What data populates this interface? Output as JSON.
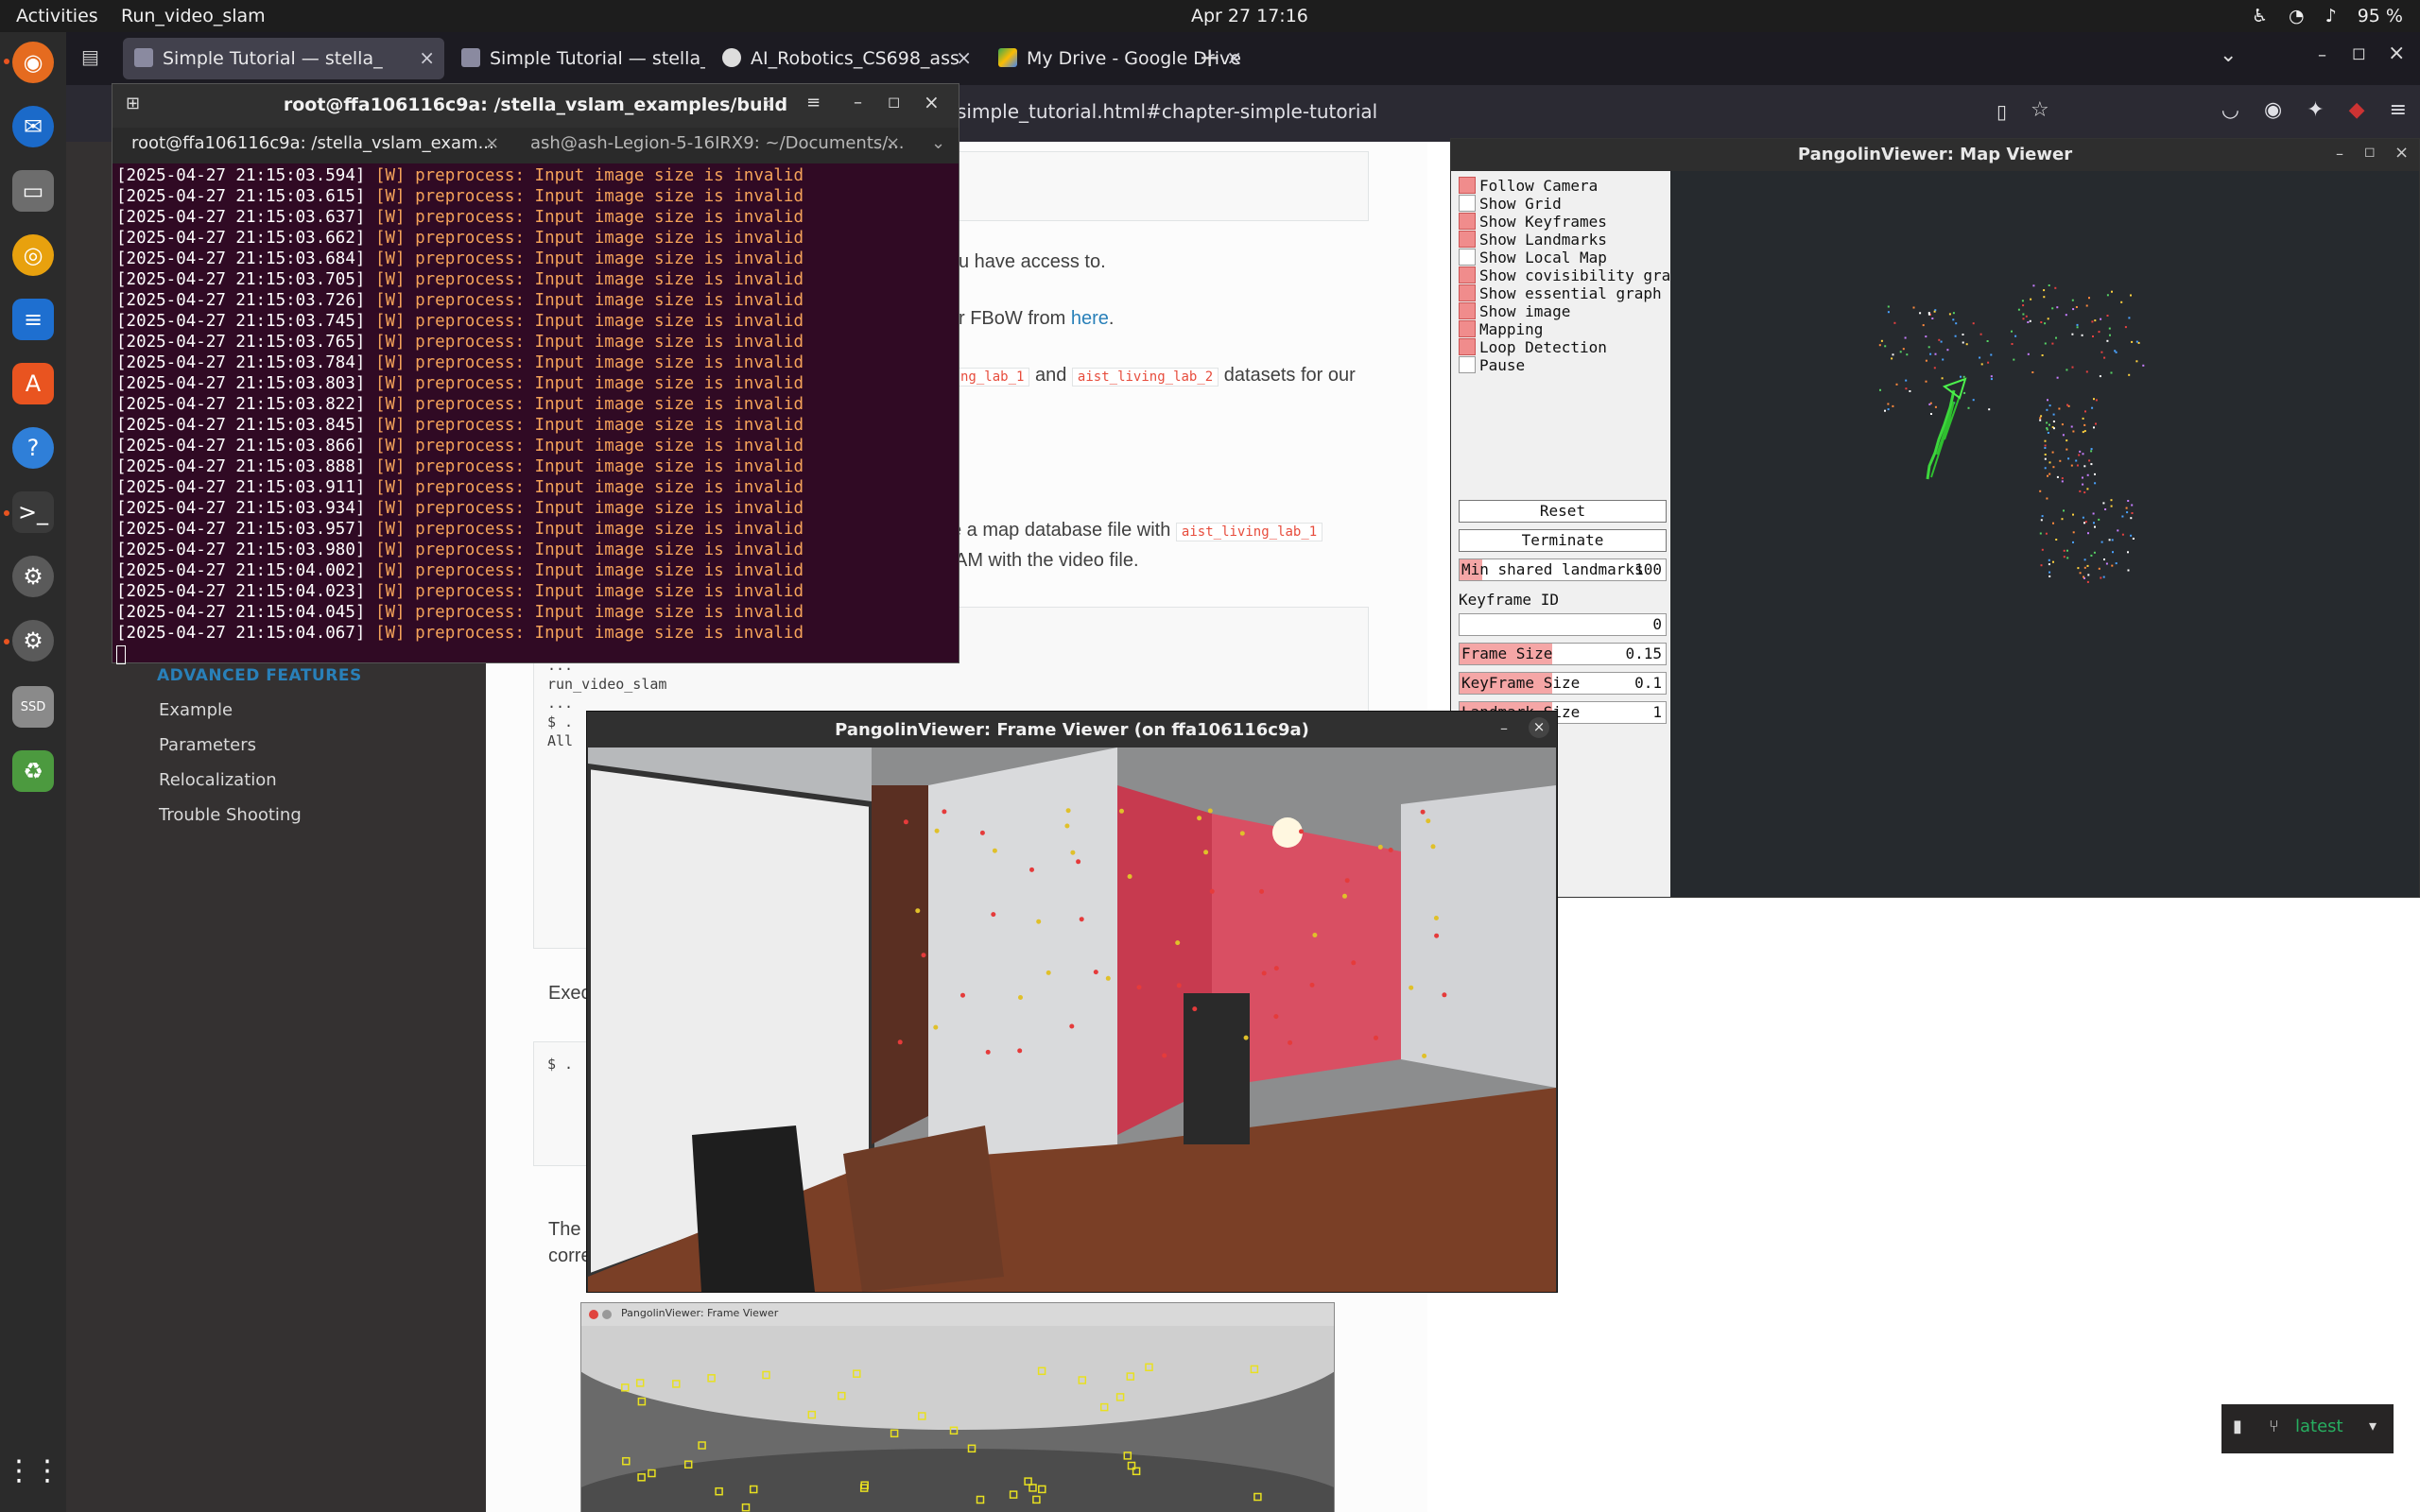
{
  "topbar": {
    "activities": "Activities",
    "app_name": "Run_video_slam",
    "clock": "Apr 27  17:16",
    "battery": "95 %"
  },
  "browser": {
    "tabs": [
      {
        "label": "Simple Tutorial — stella_"
      },
      {
        "label": "Simple Tutorial — stella_"
      },
      {
        "label": "AI_Robotics_CS698_ass"
      },
      {
        "label": "My Drive - Google Drive"
      }
    ],
    "url": "simple_tutorial.html#chapter-simple-tutorial"
  },
  "sidebar": {
    "section": "ADVANCED FEATURES",
    "items": [
      {
        "label": "Example"
      },
      {
        "label": "Parameters"
      },
      {
        "label": "Relocalization"
      },
      {
        "label": "Trouble Shooting"
      }
    ]
  },
  "content": {
    "p1": "u have access to.",
    "p2_pre": "r FBoW from ",
    "p2_link": "here",
    "p2_post": ".",
    "p3_code1": "ng_lab_1",
    "p3_and": " and ",
    "p3_code2": "aist_living_lab_2",
    "p3_post": " datasets for our",
    "p4_pre": "e a map database file with ",
    "p4_code": "aist_living_lab_1",
    "p5": "AM with the video file.",
    "code_lines": [
      "...",
      "run_video_slam",
      "...",
      "$ .",
      "All"
    ],
    "exec": "Exec",
    "code2": "$ .",
    "p6": "The f",
    "p7": "corre"
  },
  "terminal": {
    "title": "root@ffa106116c9a: /stella_vslam_examples/build",
    "tab1": "root@ffa106116c9a: /stella_vslam_exam...",
    "tab2": "ash@ash-Legion-5-16IRX9: ~/Documents/...",
    "level": "[W]",
    "message": "preprocess: Input image size is invalid",
    "lines": [
      "[2025-04-27 21:15:03.594]",
      "[2025-04-27 21:15:03.615]",
      "[2025-04-27 21:15:03.637]",
      "[2025-04-27 21:15:03.662]",
      "[2025-04-27 21:15:03.684]",
      "[2025-04-27 21:15:03.705]",
      "[2025-04-27 21:15:03.726]",
      "[2025-04-27 21:15:03.745]",
      "[2025-04-27 21:15:03.765]",
      "[2025-04-27 21:15:03.784]",
      "[2025-04-27 21:15:03.803]",
      "[2025-04-27 21:15:03.822]",
      "[2025-04-27 21:15:03.845]",
      "[2025-04-27 21:15:03.866]",
      "[2025-04-27 21:15:03.888]",
      "[2025-04-27 21:15:03.911]",
      "[2025-04-27 21:15:03.934]",
      "[2025-04-27 21:15:03.957]",
      "[2025-04-27 21:15:03.980]",
      "[2025-04-27 21:15:04.002]",
      "[2025-04-27 21:15:04.023]",
      "[2025-04-27 21:15:04.045]",
      "[2025-04-27 21:15:04.067]"
    ]
  },
  "map_viewer": {
    "title": "PangolinViewer: Map Viewer",
    "options": [
      {
        "label": "Follow Camera",
        "checked": true
      },
      {
        "label": "Show Grid",
        "checked": false
      },
      {
        "label": "Show Keyframes",
        "checked": true
      },
      {
        "label": "Show Landmarks",
        "checked": true
      },
      {
        "label": "Show Local Map",
        "checked": false
      },
      {
        "label": "Show covisibility graph",
        "checked": true
      },
      {
        "label": "Show essential graph",
        "checked": true
      },
      {
        "label": "Show image",
        "checked": true
      },
      {
        "label": "Mapping",
        "checked": true
      },
      {
        "label": "Loop Detection",
        "checked": true
      },
      {
        "label": "Pause",
        "checked": false
      }
    ],
    "reset": "Reset",
    "terminate": "Terminate",
    "min_shared_label": "Min shared landmarks",
    "min_shared_value": "100",
    "keyframe_id_label": "Keyframe ID",
    "keyframe_id_value": "0",
    "frame_size_label": "Frame Size",
    "frame_size_value": "0.15",
    "keyframe_size_label": "KeyFrame Size",
    "keyframe_size_value": "0.1",
    "landmark_size_label": "Landmark Size",
    "landmark_size_value": "1"
  },
  "frame_viewer": {
    "title": "PangolinViewer: Frame Viewer (on ffa106116c9a)"
  },
  "small_viewer": {
    "title": "PangolinViewer: Frame Viewer"
  },
  "badge": {
    "label": "latest"
  }
}
